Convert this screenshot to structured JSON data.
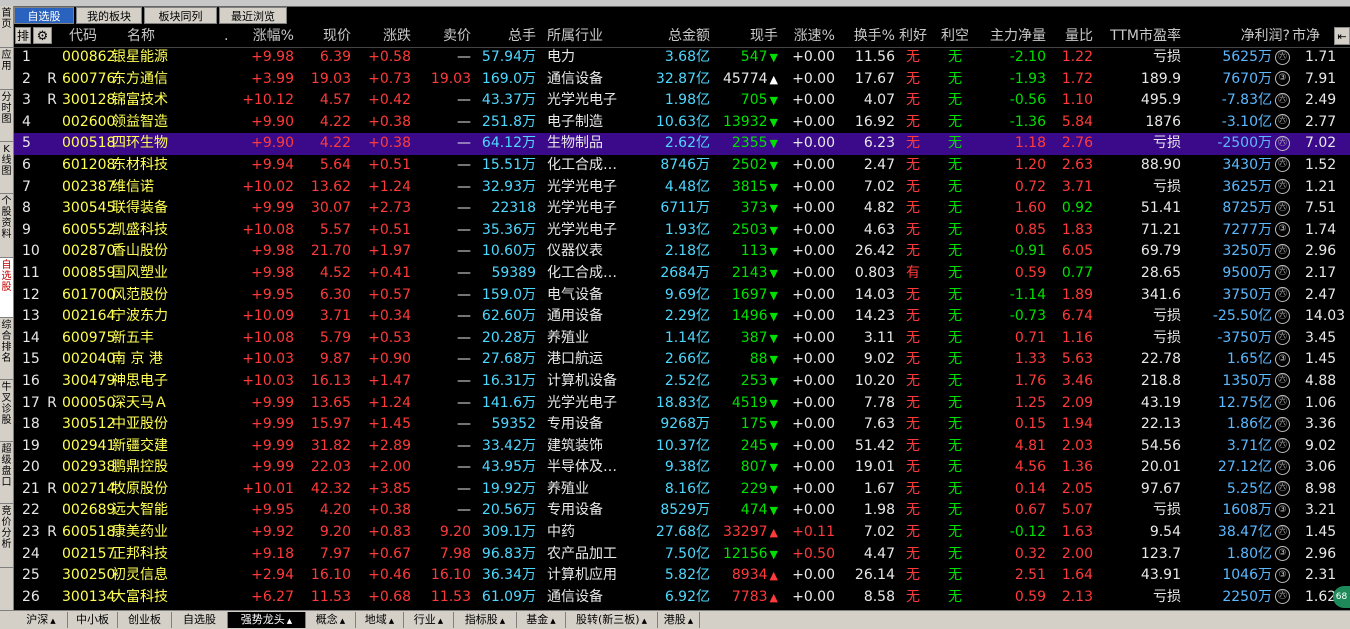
{
  "left_nav": [
    "首页",
    "应用",
    "分时图",
    "K线图",
    "个股资料",
    "自选股",
    "综合排名",
    "牛叉诊股",
    "超级盘口",
    "竞价分析"
  ],
  "left_nav_active": 5,
  "top_tabs": [
    {
      "label": "自选股",
      "active": true
    },
    {
      "label": "我的板块",
      "active": false
    },
    {
      "label": "板块同列",
      "active": false
    },
    {
      "label": "最近浏览",
      "active": false
    }
  ],
  "header": {
    "sort": "排",
    "code": "代码",
    "name": "名称",
    "dot": ".",
    "pct": "涨幅%",
    "price": "现价",
    "change": "涨跌",
    "ask": "卖价",
    "vol": "总手",
    "industry": "所属行业",
    "amount": "总金额",
    "cur_vol": "现手",
    "speed": "涨速%",
    "turnover": "换手%",
    "good": "利好",
    "bad": "利空",
    "net_inflow": "主力净量",
    "vol_ratio": "量比",
    "pe": "TTM市盈率",
    "profit": "净利润?",
    "mv": "市净"
  },
  "rows": [
    {
      "no": "1",
      "r": "",
      "code": "000862",
      "name": "银星能源",
      "pct": "+9.98",
      "price": "6.39",
      "change": "+0.58",
      "ask": "—",
      "vol": "57.94万",
      "industry": "电力",
      "amount": "3.68亿",
      "cur_vol": "547",
      "dir": "down",
      "speed": "+0.00",
      "turnover": "11.56",
      "good": "无",
      "bad": "无",
      "net": "-2.10",
      "net_pos": false,
      "ratio": "1.22",
      "ratio_high": true,
      "pe": "亏损",
      "profit": "5625万",
      "profit_badge": "㊅",
      "mv": "1.71"
    },
    {
      "no": "2",
      "r": "R",
      "code": "600776",
      "name": "东方通信",
      "pct": "+3.99",
      "price": "19.03",
      "change": "+0.73",
      "ask": "19.03",
      "vol": "169.0万",
      "industry": "通信设备",
      "amount": "32.87亿",
      "cur_vol": "45774",
      "dir": "upw",
      "speed": "+0.00",
      "turnover": "17.67",
      "good": "无",
      "bad": "无",
      "net": "-1.93",
      "net_pos": false,
      "ratio": "1.72",
      "ratio_high": true,
      "pe": "189.9",
      "profit": "7670万",
      "profit_badge": "③",
      "mv": "7.91"
    },
    {
      "no": "3",
      "r": "R",
      "code": "300128",
      "name": "锦富技术",
      "pct": "+10.12",
      "price": "4.57",
      "change": "+0.42",
      "ask": "—",
      "vol": "43.37万",
      "industry": "光学光电子",
      "amount": "1.98亿",
      "cur_vol": "705",
      "dir": "down",
      "speed": "+0.00",
      "turnover": "4.07",
      "good": "无",
      "bad": "无",
      "net": "-0.56",
      "net_pos": false,
      "ratio": "1.10",
      "ratio_high": true,
      "pe": "495.9",
      "profit": "-7.83亿",
      "profit_badge": "㊅",
      "mv": "2.49"
    },
    {
      "no": "4",
      "r": "",
      "code": "002600",
      "name": "领益智造",
      "pct": "+9.90",
      "price": "4.22",
      "change": "+0.38",
      "ask": "—",
      "vol": "251.8万",
      "industry": "电子制造",
      "amount": "10.63亿",
      "cur_vol": "13932",
      "dir": "down",
      "speed": "+0.00",
      "turnover": "16.92",
      "good": "无",
      "bad": "无",
      "net": "-1.36",
      "net_pos": false,
      "ratio": "5.84",
      "ratio_high": true,
      "pe": "1876",
      "profit": "-3.10亿",
      "profit_badge": "㊅",
      "mv": "2.77"
    },
    {
      "no": "5",
      "r": "",
      "code": "000518",
      "name": "四环生物",
      "pct": "+9.90",
      "price": "4.22",
      "change": "+0.38",
      "ask": "—",
      "vol": "64.12万",
      "industry": "生物制品",
      "amount": "2.62亿",
      "cur_vol": "2355",
      "dir": "down",
      "speed": "+0.00",
      "turnover": "6.23",
      "good": "无",
      "bad": "无",
      "net": "1.18",
      "net_pos": true,
      "ratio": "2.76",
      "ratio_high": true,
      "pe": "亏损",
      "profit": "-2500万",
      "profit_badge": "㊅",
      "mv": "7.02",
      "selected": true
    },
    {
      "no": "6",
      "r": "",
      "code": "601208",
      "name": "东材科技",
      "pct": "+9.94",
      "price": "5.64",
      "change": "+0.51",
      "ask": "—",
      "vol": "15.51万",
      "industry": "化工合成…",
      "amount": "8746万",
      "cur_vol": "2502",
      "dir": "down",
      "speed": "+0.00",
      "turnover": "2.47",
      "good": "无",
      "bad": "无",
      "net": "1.20",
      "net_pos": true,
      "ratio": "2.63",
      "ratio_high": true,
      "pe": "88.90",
      "profit": "3430万",
      "profit_badge": "㊅",
      "mv": "1.52"
    },
    {
      "no": "7",
      "r": "",
      "code": "002387",
      "name": "维信诺",
      "pct": "+10.02",
      "price": "13.62",
      "change": "+1.24",
      "ask": "—",
      "vol": "32.93万",
      "industry": "光学光电子",
      "amount": "4.48亿",
      "cur_vol": "3815",
      "dir": "down",
      "speed": "+0.00",
      "turnover": "7.02",
      "good": "无",
      "bad": "无",
      "net": "0.72",
      "net_pos": true,
      "ratio": "3.71",
      "ratio_high": true,
      "pe": "亏损",
      "profit": "3625万",
      "profit_badge": "㊅",
      "mv": "1.21"
    },
    {
      "no": "8",
      "r": "",
      "code": "300545",
      "name": "联得装备",
      "pct": "+9.99",
      "price": "30.07",
      "change": "+2.73",
      "ask": "—",
      "vol": "22318",
      "industry": "光学光电子",
      "amount": "6711万",
      "cur_vol": "373",
      "dir": "down",
      "speed": "+0.00",
      "turnover": "4.82",
      "good": "无",
      "bad": "无",
      "net": "1.60",
      "net_pos": true,
      "ratio": "0.92",
      "ratio_high": false,
      "pe": "51.41",
      "profit": "8725万",
      "profit_badge": "㊅",
      "mv": "7.51"
    },
    {
      "no": "9",
      "r": "",
      "code": "600552",
      "name": "凯盛科技",
      "pct": "+10.08",
      "price": "5.57",
      "change": "+0.51",
      "ask": "—",
      "vol": "35.36万",
      "industry": "光学光电子",
      "amount": "1.93亿",
      "cur_vol": "2503",
      "dir": "down",
      "speed": "+0.00",
      "turnover": "4.63",
      "good": "无",
      "bad": "无",
      "net": "0.85",
      "net_pos": true,
      "ratio": "1.83",
      "ratio_high": true,
      "pe": "71.21",
      "profit": "7277万",
      "profit_badge": "③",
      "mv": "1.74"
    },
    {
      "no": "10",
      "r": "",
      "code": "002870",
      "name": "香山股份",
      "pct": "+9.98",
      "price": "21.70",
      "change": "+1.97",
      "ask": "—",
      "vol": "10.60万",
      "industry": "仪器仪表",
      "amount": "2.18亿",
      "cur_vol": "113",
      "dir": "down",
      "speed": "+0.00",
      "turnover": "26.42",
      "good": "无",
      "bad": "无",
      "net": "-0.91",
      "net_pos": false,
      "ratio": "6.05",
      "ratio_high": true,
      "pe": "69.79",
      "profit": "3250万",
      "profit_badge": "㊅",
      "mv": "2.96"
    },
    {
      "no": "11",
      "r": "",
      "code": "000859",
      "name": "国风塑业",
      "pct": "+9.98",
      "price": "4.52",
      "change": "+0.41",
      "ask": "—",
      "vol": "59389",
      "industry": "化工合成…",
      "amount": "2684万",
      "cur_vol": "2143",
      "dir": "down",
      "speed": "+0.00",
      "turnover": "0.803",
      "good": "有",
      "bad": "无",
      "net": "0.59",
      "net_pos": true,
      "ratio": "0.77",
      "ratio_high": false,
      "pe": "28.65",
      "profit": "9500万",
      "profit_badge": "㊅",
      "mv": "2.17"
    },
    {
      "no": "12",
      "r": "",
      "code": "601700",
      "name": "风范股份",
      "pct": "+9.95",
      "price": "6.30",
      "change": "+0.57",
      "ask": "—",
      "vol": "159.0万",
      "industry": "电气设备",
      "amount": "9.69亿",
      "cur_vol": "1697",
      "dir": "down",
      "speed": "+0.00",
      "turnover": "14.03",
      "good": "无",
      "bad": "无",
      "net": "-1.14",
      "net_pos": false,
      "ratio": "1.89",
      "ratio_high": true,
      "pe": "341.6",
      "profit": "3750万",
      "profit_badge": "㊅",
      "mv": "2.47"
    },
    {
      "no": "13",
      "r": "",
      "code": "002164",
      "name": "宁波东力",
      "pct": "+10.09",
      "price": "3.71",
      "change": "+0.34",
      "ask": "—",
      "vol": "62.60万",
      "industry": "通用设备",
      "amount": "2.29亿",
      "cur_vol": "1496",
      "dir": "down",
      "speed": "+0.00",
      "turnover": "14.23",
      "good": "无",
      "bad": "无",
      "net": "-0.73",
      "net_pos": false,
      "ratio": "6.74",
      "ratio_high": true,
      "pe": "亏损",
      "profit": "-25.50亿",
      "profit_badge": "㊅",
      "mv": "14.03"
    },
    {
      "no": "14",
      "r": "",
      "code": "600975",
      "name": "新五丰",
      "pct": "+10.08",
      "price": "5.79",
      "change": "+0.53",
      "ask": "—",
      "vol": "20.28万",
      "industry": "养殖业",
      "amount": "1.14亿",
      "cur_vol": "387",
      "dir": "down",
      "speed": "+0.00",
      "turnover": "3.11",
      "good": "无",
      "bad": "无",
      "net": "0.71",
      "net_pos": true,
      "ratio": "1.16",
      "ratio_high": true,
      "pe": "亏损",
      "profit": "-3750万",
      "profit_badge": "㊅",
      "mv": "3.45"
    },
    {
      "no": "15",
      "r": "",
      "code": "002040",
      "name": "南 京 港",
      "pct": "+10.03",
      "price": "9.87",
      "change": "+0.90",
      "ask": "—",
      "vol": "27.68万",
      "industry": "港口航运",
      "amount": "2.66亿",
      "cur_vol": "88",
      "dir": "down",
      "speed": "+0.00",
      "turnover": "9.02",
      "good": "无",
      "bad": "无",
      "net": "1.33",
      "net_pos": true,
      "ratio": "5.63",
      "ratio_high": true,
      "pe": "22.78",
      "profit": "1.65亿",
      "profit_badge": "③",
      "mv": "1.45"
    },
    {
      "no": "16",
      "r": "",
      "code": "300479",
      "name": "神思电子",
      "pct": "+10.03",
      "price": "16.13",
      "change": "+1.47",
      "ask": "—",
      "vol": "16.31万",
      "industry": "计算机设备",
      "amount": "2.52亿",
      "cur_vol": "253",
      "dir": "down",
      "speed": "+0.00",
      "turnover": "10.20",
      "good": "无",
      "bad": "无",
      "net": "1.76",
      "net_pos": true,
      "ratio": "3.46",
      "ratio_high": true,
      "pe": "218.8",
      "profit": "1350万",
      "profit_badge": "㊅",
      "mv": "4.88"
    },
    {
      "no": "17",
      "r": "R",
      "code": "000050",
      "name": "深天马Ａ",
      "pct": "+9.99",
      "price": "13.65",
      "change": "+1.24",
      "ask": "—",
      "vol": "141.6万",
      "industry": "光学光电子",
      "amount": "18.83亿",
      "cur_vol": "4519",
      "dir": "down",
      "speed": "+0.00",
      "turnover": "7.78",
      "good": "无",
      "bad": "无",
      "net": "1.25",
      "net_pos": true,
      "ratio": "2.09",
      "ratio_high": true,
      "pe": "43.19",
      "profit": "12.75亿",
      "profit_badge": "㊅",
      "mv": "1.06"
    },
    {
      "no": "18",
      "r": "",
      "code": "300512",
      "name": "中亚股份",
      "pct": "+9.99",
      "price": "15.97",
      "change": "+1.45",
      "ask": "—",
      "vol": "59352",
      "industry": "专用设备",
      "amount": "9268万",
      "cur_vol": "175",
      "dir": "down",
      "speed": "+0.00",
      "turnover": "7.63",
      "good": "无",
      "bad": "无",
      "net": "0.15",
      "net_pos": true,
      "ratio": "1.94",
      "ratio_high": true,
      "pe": "22.13",
      "profit": "1.86亿",
      "profit_badge": "㊅",
      "mv": "3.36"
    },
    {
      "no": "19",
      "r": "",
      "code": "002941",
      "name": "新疆交建",
      "pct": "+9.99",
      "price": "31.82",
      "change": "+2.89",
      "ask": "—",
      "vol": "33.42万",
      "industry": "建筑装饰",
      "amount": "10.37亿",
      "cur_vol": "245",
      "dir": "down",
      "speed": "+0.00",
      "turnover": "51.42",
      "good": "无",
      "bad": "无",
      "net": "4.81",
      "net_pos": true,
      "ratio": "2.03",
      "ratio_high": true,
      "pe": "54.56",
      "profit": "3.71亿",
      "profit_badge": "㊅",
      "mv": "9.02"
    },
    {
      "no": "20",
      "r": "",
      "code": "002938",
      "name": "鹏鼎控股",
      "pct": "+9.99",
      "price": "22.03",
      "change": "+2.00",
      "ask": "—",
      "vol": "43.95万",
      "industry": "半导体及…",
      "amount": "9.38亿",
      "cur_vol": "807",
      "dir": "down",
      "speed": "+0.00",
      "turnover": "19.01",
      "good": "无",
      "bad": "无",
      "net": "4.56",
      "net_pos": true,
      "ratio": "1.36",
      "ratio_high": true,
      "pe": "20.01",
      "profit": "27.12亿",
      "profit_badge": "㊅",
      "mv": "3.06"
    },
    {
      "no": "21",
      "r": "R",
      "code": "002714",
      "name": "牧原股份",
      "pct": "+10.01",
      "price": "42.32",
      "change": "+3.85",
      "ask": "—",
      "vol": "19.92万",
      "industry": "养殖业",
      "amount": "8.16亿",
      "cur_vol": "229",
      "dir": "down",
      "speed": "+0.00",
      "turnover": "1.67",
      "good": "无",
      "bad": "无",
      "net": "0.14",
      "net_pos": true,
      "ratio": "2.05",
      "ratio_high": true,
      "pe": "97.67",
      "profit": "5.25亿",
      "profit_badge": "㊅",
      "mv": "8.98"
    },
    {
      "no": "22",
      "r": "",
      "code": "002689",
      "name": "远大智能",
      "pct": "+9.95",
      "price": "4.20",
      "change": "+0.38",
      "ask": "—",
      "vol": "20.56万",
      "industry": "专用设备",
      "amount": "8529万",
      "cur_vol": "474",
      "dir": "down",
      "speed": "+0.00",
      "turnover": "1.98",
      "good": "无",
      "bad": "无",
      "net": "0.67",
      "net_pos": true,
      "ratio": "5.07",
      "ratio_high": true,
      "pe": "亏损",
      "profit": "1608万",
      "profit_badge": "③",
      "mv": "3.21"
    },
    {
      "no": "23",
      "r": "R",
      "code": "600518",
      "name": "康美药业",
      "pct": "+9.92",
      "price": "9.20",
      "change": "+0.83",
      "ask": "9.20",
      "vol": "309.1万",
      "industry": "中药",
      "amount": "27.68亿",
      "cur_vol": "33297",
      "dir": "upr",
      "speed": "+0.11",
      "turnover": "7.02",
      "good": "无",
      "bad": "无",
      "net": "-0.12",
      "net_pos": false,
      "ratio": "1.63",
      "ratio_high": true,
      "pe": "9.54",
      "profit": "38.47亿",
      "profit_badge": "㊅",
      "mv": "1.45"
    },
    {
      "no": "24",
      "r": "",
      "code": "002157",
      "name": "正邦科技",
      "pct": "+9.18",
      "price": "7.97",
      "change": "+0.67",
      "ask": "7.98",
      "vol": "96.83万",
      "industry": "农产品加工",
      "amount": "7.50亿",
      "cur_vol": "12156",
      "dir": "down",
      "speed": "+0.50",
      "turnover": "4.47",
      "good": "无",
      "bad": "无",
      "net": "0.32",
      "net_pos": true,
      "ratio": "2.00",
      "ratio_high": true,
      "pe": "123.7",
      "profit": "1.80亿",
      "profit_badge": "③",
      "mv": "2.96"
    },
    {
      "no": "25",
      "r": "",
      "code": "300250",
      "name": "初灵信息",
      "pct": "+2.94",
      "price": "16.10",
      "change": "+0.46",
      "ask": "16.10",
      "vol": "36.34万",
      "industry": "计算机应用",
      "amount": "5.82亿",
      "cur_vol": "8934",
      "dir": "upr",
      "speed": "+0.00",
      "turnover": "26.14",
      "good": "无",
      "bad": "无",
      "net": "2.51",
      "net_pos": true,
      "ratio": "1.64",
      "ratio_high": true,
      "pe": "43.91",
      "profit": "1046万",
      "profit_badge": "③",
      "mv": "2.31"
    },
    {
      "no": "26",
      "r": "",
      "code": "300134",
      "name": "大富科技",
      "pct": "+6.27",
      "price": "11.53",
      "change": "+0.68",
      "ask": "11.53",
      "vol": "61.09万",
      "industry": "通信设备",
      "amount": "6.92亿",
      "cur_vol": "7783",
      "dir": "upr",
      "speed": "+0.00",
      "turnover": "8.58",
      "good": "无",
      "bad": "无",
      "net": "0.59",
      "net_pos": true,
      "ratio": "2.13",
      "ratio_high": true,
      "pe": "亏损",
      "profit": "2250万",
      "profit_badge": "㊅",
      "mv": "1.62"
    }
  ],
  "bottom_tabs": [
    {
      "label": "沪深",
      "tri": true
    },
    {
      "label": "中小板",
      "tri": false
    },
    {
      "label": "创业板",
      "tri": false
    },
    {
      "label": "自选股",
      "tri": false
    },
    {
      "label": "强势龙头",
      "tri": true,
      "active": true
    },
    {
      "label": "概念",
      "tri": true
    },
    {
      "label": "地域",
      "tri": true
    },
    {
      "label": "行业",
      "tri": true
    },
    {
      "label": "指标股",
      "tri": true
    },
    {
      "label": "基金",
      "tri": true
    },
    {
      "label": "股转(新三板)",
      "tri": true
    },
    {
      "label": "港股",
      "tri": true
    }
  ],
  "corner_badge": "68",
  "icons": {
    "gear": "gear-icon",
    "scroll": "scroll-right-icon"
  }
}
